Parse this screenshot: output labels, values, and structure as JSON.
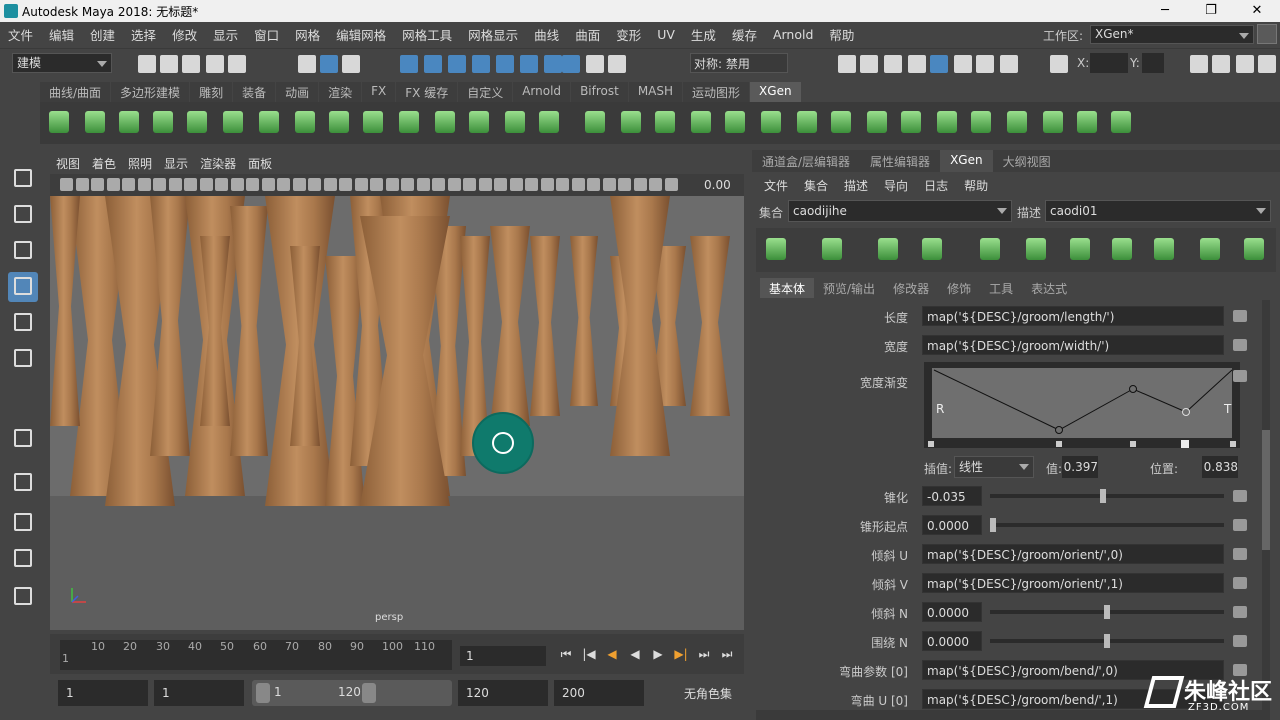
{
  "titlebar": {
    "title": "Autodesk Maya 2018: 无标题*",
    "minimize": "─",
    "maximize": "❐",
    "close": "✕"
  },
  "menubar": {
    "items": [
      "文件",
      "编辑",
      "创建",
      "选择",
      "修改",
      "显示",
      "窗口",
      "网格",
      "编辑网格",
      "网格工具",
      "网格显示",
      "曲线",
      "曲面",
      "变形",
      "UV",
      "生成",
      "缓存",
      "Arnold",
      "帮助"
    ]
  },
  "workspace": {
    "label": "工作区:",
    "value": "XGen*"
  },
  "statusline": {
    "mode": "建模",
    "symmetry": "对称: 禁用",
    "x_label": "X:",
    "y_label": "Y:"
  },
  "shelf": {
    "tabs": [
      "曲线/曲面",
      "多边形建模",
      "雕刻",
      "装备",
      "动画",
      "渲染",
      "FX",
      "FX 缓存",
      "自定义",
      "Arnold",
      "Bifrost",
      "MASH",
      "运动图形",
      "XGen"
    ],
    "active_tab": "XGen"
  },
  "viewport": {
    "menu": [
      "视图",
      "着色",
      "照明",
      "显示",
      "渲染器",
      "面板"
    ],
    "value": "0.00",
    "camera": "persp"
  },
  "timeslider": {
    "ticks": [
      "10",
      "20",
      "30",
      "40",
      "50",
      "60",
      "70",
      "80",
      "90",
      "100",
      "110"
    ],
    "start_label": "1",
    "current_frame": "1"
  },
  "playback": {
    "btn_first": "⏮",
    "btn_prev_key": "|◀",
    "btn_prev": "◀",
    "btn_play": "▶",
    "btn_next_key": "▶|",
    "btn_next": "⏭",
    "btn_last": "⏭"
  },
  "rangebar": {
    "start": "1",
    "play_start": "1",
    "slider_min": "1",
    "slider_max": "120",
    "play_end": "120",
    "end": "200",
    "anim_layer": "无角色集"
  },
  "panel": {
    "tabs": [
      "通道盒/层编辑器",
      "属性编辑器",
      "XGen",
      "大纲视图"
    ],
    "active_tab": "XGen",
    "menu": [
      "文件",
      "集合",
      "描述",
      "导向",
      "日志",
      "帮助"
    ],
    "collection_label": "集合",
    "collection": "caodijihe",
    "description_label": "描述",
    "description": "caodi01",
    "sub_tabs": [
      "基本体",
      "预览/输出",
      "修改器",
      "修饰",
      "工具",
      "表达式"
    ],
    "active_sub_tab": "基本体",
    "ramp_label": "宽度渐变",
    "ramp_R": "R",
    "ramp_T": "T",
    "interp_label": "插值:",
    "interp_value": "线性",
    "value_label": "值:",
    "value": "0.397",
    "position_label": "位置:",
    "position": "0.838",
    "props": [
      {
        "label": "长度",
        "value": "map('${DESC}/groom/length/')"
      },
      {
        "label": "宽度",
        "value": "map('${DESC}/groom/width/')"
      },
      {
        "label": "锥化",
        "value": "-0.035"
      },
      {
        "label": "锥形起点",
        "value": "0.0000"
      },
      {
        "label": "倾斜 U",
        "value": "map('${DESC}/groom/orient/',0)"
      },
      {
        "label": "倾斜 V",
        "value": "map('${DESC}/groom/orient/',1)"
      },
      {
        "label": "倾斜 N",
        "value": "0.0000"
      },
      {
        "label": "围绕 N",
        "value": "0.0000"
      },
      {
        "label": "弯曲参数 [0]",
        "value": "map('${DESC}/groom/bend/',0)"
      },
      {
        "label": "弯曲 U [0]",
        "value": "map('${DESC}/groom/bend/',1)"
      }
    ]
  },
  "watermark": {
    "text": "朱峰社区",
    "sub": "ZF3D.COM"
  }
}
